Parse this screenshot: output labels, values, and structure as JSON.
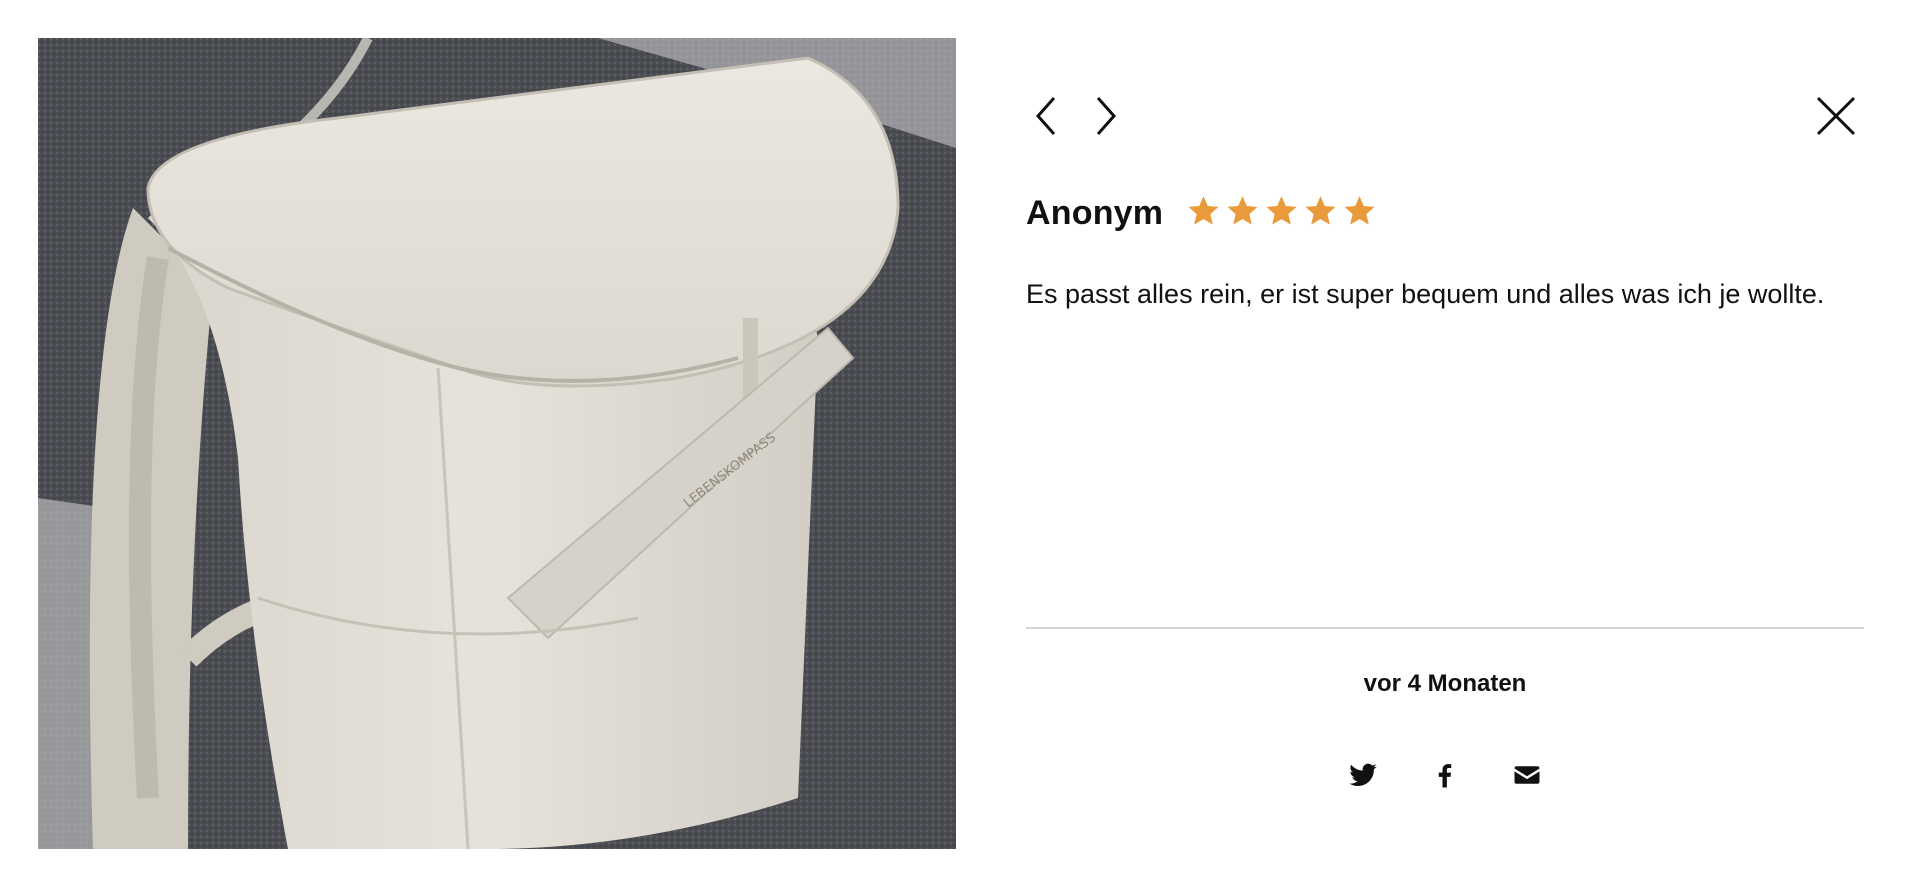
{
  "photo": {
    "alt": "Beiger Rucksack auf grauem Teppich",
    "logo_text": "LEBENSKOMPASS"
  },
  "nav": {
    "prev_icon": "chevron-left-icon",
    "next_icon": "chevron-right-icon",
    "close_icon": "close-icon"
  },
  "review": {
    "author": "Anonym",
    "rating": 5,
    "rating_max": 5,
    "star_color": "#e99b3b",
    "text": "Es passt alles rein, er ist super bequem und alles was ich je wollte.",
    "timestamp": "vor 4 Monaten"
  },
  "share": {
    "icons": [
      "twitter-icon",
      "facebook-icon",
      "mail-icon"
    ]
  }
}
